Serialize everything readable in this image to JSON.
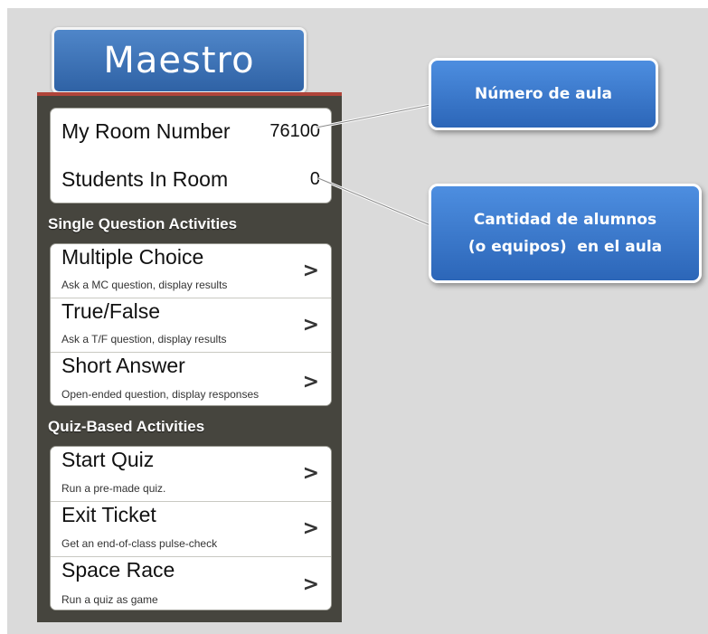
{
  "title": "Maestro",
  "room": {
    "room_number_label": "My Room Number",
    "room_number_value": "76100",
    "students_label": "Students In Room",
    "students_value": "0"
  },
  "single_section": {
    "header": "Single Question Activities",
    "items": [
      {
        "title": "Multiple Choice",
        "subtitle": "Ask a MC question, display results",
        "chevron": ">"
      },
      {
        "title": "True/False",
        "subtitle": "Ask a T/F question, display results",
        "chevron": ">"
      },
      {
        "title": "Short Answer",
        "subtitle": "Open-ended question, display responses",
        "chevron": ">"
      }
    ]
  },
  "quiz_section": {
    "header": "Quiz-Based Activities",
    "items": [
      {
        "title": "Start Quiz",
        "subtitle": "Run a pre-made quiz.",
        "chevron": ">"
      },
      {
        "title": "Exit Ticket",
        "subtitle": "Get an end-of-class pulse-check",
        "chevron": ">"
      },
      {
        "title": "Space Race",
        "subtitle": "Run a quiz as game",
        "chevron": ">"
      }
    ]
  },
  "callouts": {
    "room_number": "Número de aula",
    "students_line1": "Cantidad de alumnos",
    "students_line2": "(o equipos)  en el aula"
  },
  "colors": {
    "background": "#dadada",
    "phone_background": "#46453e",
    "title_blue": "#3a6fb3",
    "callout_blue": "#3a7ad0"
  }
}
